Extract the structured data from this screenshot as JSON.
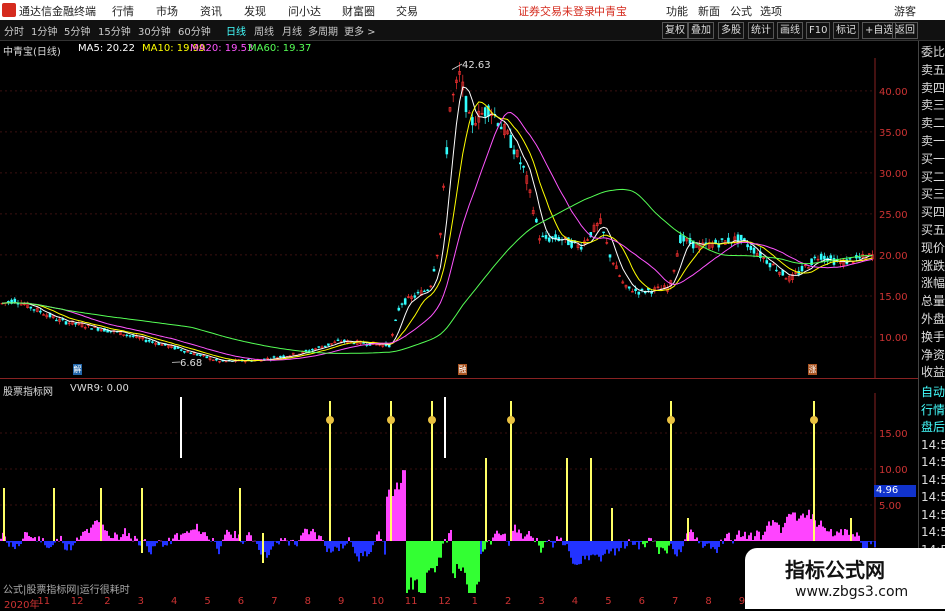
{
  "menubar": {
    "app_name": "通达信金融终端",
    "items": [
      "行情",
      "市场",
      "资讯",
      "发现",
      "问小达",
      "财富圈",
      "交易"
    ],
    "status": "证券交易未登录",
    "stock_name": "中青宝",
    "right_items": [
      "功能",
      "新面",
      "公式",
      "选项"
    ],
    "guest": "游客"
  },
  "toolbar": {
    "periods": [
      "分时",
      "1分钟",
      "5分钟",
      "15分钟",
      "30分钟",
      "60分钟",
      "日线",
      "周线",
      "月线",
      "多周期",
      "更多 >"
    ],
    "active_period": "日线",
    "right_buttons": [
      "复权",
      "叠加",
      "多股",
      "统计",
      "画线",
      "F10",
      "标记",
      "+自选",
      "返回"
    ]
  },
  "main_chart": {
    "title": "中青宝(日线)",
    "ma_labels": [
      {
        "text": "MA5: 20.22",
        "color": "#ffffff"
      },
      {
        "text": "MA10: 19.99",
        "color": "#ffff00"
      },
      {
        "text": "MA20: 19.53",
        "color": "#ff55ff"
      },
      {
        "text": "MA60: 19.37",
        "color": "#55ff55"
      }
    ],
    "y_ticks": [
      "40.00",
      "35.00",
      "30.00",
      "25.00",
      "20.00",
      "15.00",
      "10.00"
    ],
    "high_label": "42.63",
    "low_label": "6.68",
    "markers": [
      "解",
      "融",
      "涨"
    ]
  },
  "sub_chart": {
    "title": "股票指标网",
    "indicator": "VWR9: 0.00",
    "y_ticks": [
      "15.00",
      "10.00",
      "5.00"
    ],
    "current_value": "4.96",
    "footer": "公式|股票指标网|运行很耗时"
  },
  "x_axis": [
    "2020年",
    "11",
    "12",
    "2",
    "3",
    "4",
    "5",
    "6",
    "7",
    "8",
    "9",
    "10",
    "11",
    "12",
    "1",
    "2",
    "3",
    "4",
    "5",
    "6",
    "7",
    "8",
    "9",
    "10",
    "11",
    "12",
    "1"
  ],
  "sidebar": {
    "items": [
      "委比",
      "卖五",
      "卖四",
      "卖三",
      "卖二",
      "卖一",
      "买一",
      "买二",
      "买三",
      "买四",
      "买五",
      "现价",
      "涨跌",
      "涨幅",
      "总量",
      "外盘",
      "换手",
      "净资",
      "收益"
    ],
    "items2": [
      "自动",
      "行情",
      "盘后",
      "14:5",
      "14:5",
      "14:5",
      "14:5",
      "14:5",
      "14:5",
      "14:5",
      "14:5",
      "14:5"
    ]
  },
  "watermark": {
    "title": "指标公式网",
    "url": "www.zbgs3.com"
  },
  "colors": {
    "up": "#ff3333",
    "down": "#33ffff",
    "ma5": "#ffffff",
    "ma10": "#ffff00",
    "ma20": "#ff55ff",
    "ma60": "#55ff55",
    "pos_fill": "#ff44ff",
    "neg_fill": "#2233ff",
    "green_fill": "#33ff33",
    "signal": "#ffff66"
  }
}
